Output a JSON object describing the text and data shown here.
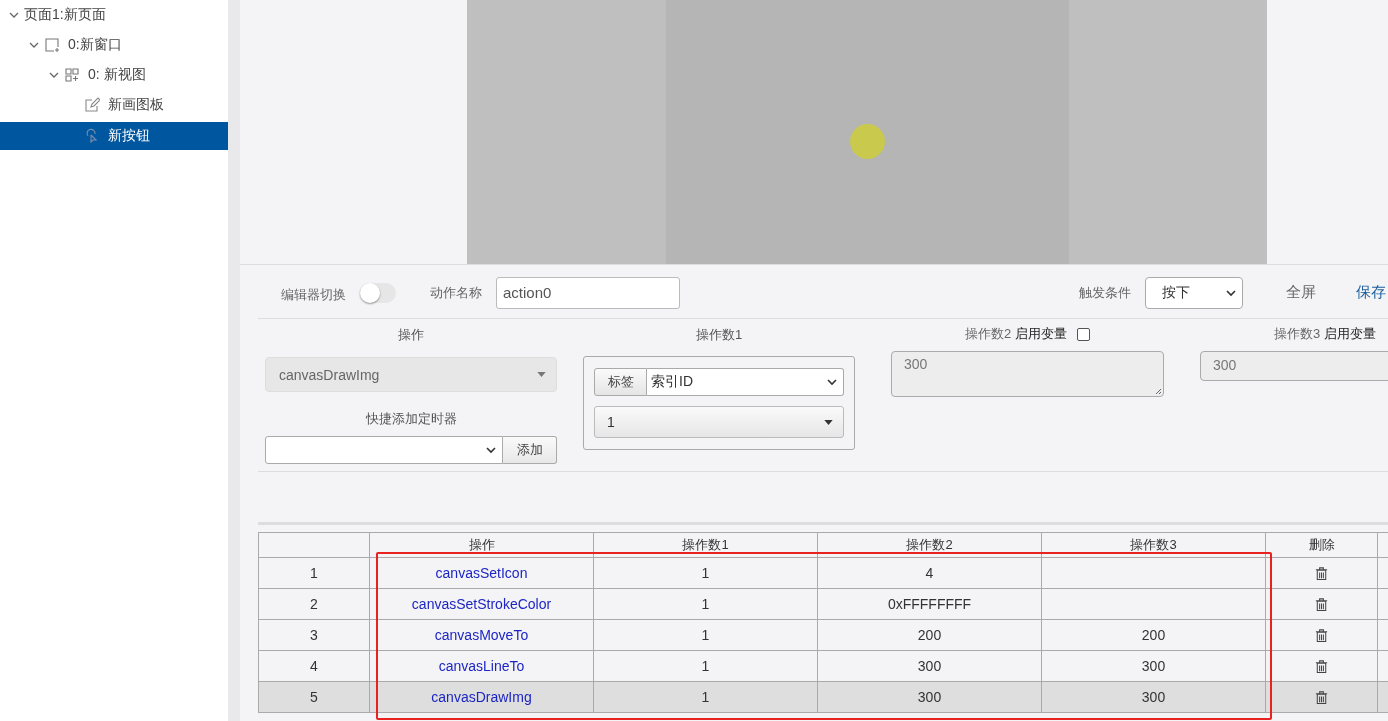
{
  "sidebar": {
    "tree": [
      {
        "label": "页面1:新页面",
        "expanded": true,
        "selected": false,
        "children": [
          {
            "label": "0:新窗口",
            "kind": "window",
            "expanded": true,
            "selected": false,
            "children": [
              {
                "label": "0: 新视图",
                "kind": "view",
                "expanded": true,
                "selected": false,
                "children": [
                  {
                    "label": "新画图板",
                    "kind": "board",
                    "selected": false
                  },
                  {
                    "label": "新按钮",
                    "kind": "button",
                    "selected": true
                  }
                ]
              }
            ]
          }
        ]
      }
    ]
  },
  "toolbar": {
    "editor_switch": {
      "label": "编辑器切换",
      "on": false
    },
    "action_name": {
      "label": "动作名称",
      "value": "action0"
    },
    "trigger": {
      "label": "触发条件",
      "value": "按下"
    },
    "fullscreen": "全屏",
    "save": "保存"
  },
  "form": {
    "operation": {
      "label": "操作",
      "value": "canvasDrawImg",
      "disabled": true
    },
    "timer": {
      "label": "快捷添加定时器",
      "button": "添加"
    },
    "operand1": {
      "label": "操作数1",
      "tag_button": "标签",
      "tag_select": "索引ID",
      "value": "1"
    },
    "operand2": {
      "label": "操作数2",
      "var_label": "启用变量",
      "var_checked": false,
      "value": "300"
    },
    "operand3": {
      "label": "操作数3",
      "var_label": "启用变量",
      "value": "300"
    }
  },
  "table": {
    "columns": [
      "操作",
      "操作数1",
      "操作数2",
      "操作数3",
      "删除"
    ],
    "rows": [
      {
        "index": "1",
        "operation": "canvasSetIcon",
        "operand1": "1",
        "operand2": "4",
        "selected": false
      },
      {
        "index": "2",
        "operation": "canvasSetStrokeColor",
        "operand1": "1",
        "operand2": "0xFFFFFFFF",
        "selected": false
      },
      {
        "index": "3",
        "operation": "canvasMoveTo",
        "operand1": "1",
        "operand2": "200",
        "operand3": "200",
        "selected": false
      },
      {
        "index": "4",
        "operation": "canvasLineTo",
        "operand1": "1",
        "operand2": "300",
        "operand3": "300",
        "selected": false
      },
      {
        "index": "5",
        "operation": "canvasDrawImg",
        "operand1": "1",
        "operand2": "300",
        "operand3": "300",
        "selected": true
      }
    ]
  }
}
